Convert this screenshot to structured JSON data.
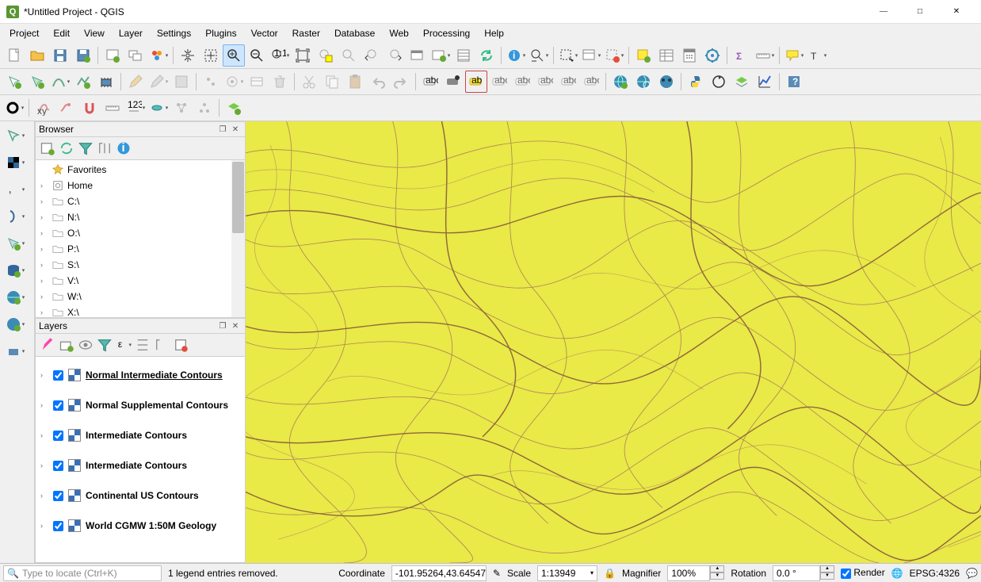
{
  "title": "*Untitled Project - QGIS",
  "menu": [
    "Project",
    "Edit",
    "View",
    "Layer",
    "Settings",
    "Plugins",
    "Vector",
    "Raster",
    "Database",
    "Web",
    "Processing",
    "Help"
  ],
  "browser": {
    "title": "Browser",
    "items": [
      {
        "icon": "star",
        "label": "Favorites",
        "expand": ""
      },
      {
        "icon": "home",
        "label": "Home",
        "expand": "›"
      },
      {
        "icon": "drive",
        "label": "C:\\",
        "expand": "›"
      },
      {
        "icon": "drive",
        "label": "N:\\",
        "expand": "›"
      },
      {
        "icon": "drive",
        "label": "O:\\",
        "expand": "›"
      },
      {
        "icon": "drive",
        "label": "P:\\",
        "expand": "›"
      },
      {
        "icon": "drive",
        "label": "S:\\",
        "expand": "›"
      },
      {
        "icon": "drive",
        "label": "V:\\",
        "expand": "›"
      },
      {
        "icon": "drive",
        "label": "W:\\",
        "expand": "›"
      },
      {
        "icon": "drive",
        "label": "X:\\",
        "expand": "›"
      }
    ]
  },
  "layers": {
    "title": "Layers",
    "items": [
      {
        "label": "Normal Intermediate Contours",
        "sel": true
      },
      {
        "label": "Normal Supplemental Contours"
      },
      {
        "label": "Intermediate Contours"
      },
      {
        "label": "Intermediate Contours"
      },
      {
        "label": "Continental US Contours"
      },
      {
        "label": "World CGMW 1:50M Geology"
      }
    ]
  },
  "status": {
    "locate_ph": "Type to locate (Ctrl+K)",
    "entries": "1 legend entries removed.",
    "coord_lbl": "Coordinate",
    "coord": "-101.95264,43.64547",
    "scale_lbl": "Scale",
    "scale": "1:13949",
    "mag_lbl": "Magnifier",
    "mag": "100%",
    "rot_lbl": "Rotation",
    "rot": "0.0 °",
    "render": "Render",
    "epsg": "EPSG:4326"
  }
}
